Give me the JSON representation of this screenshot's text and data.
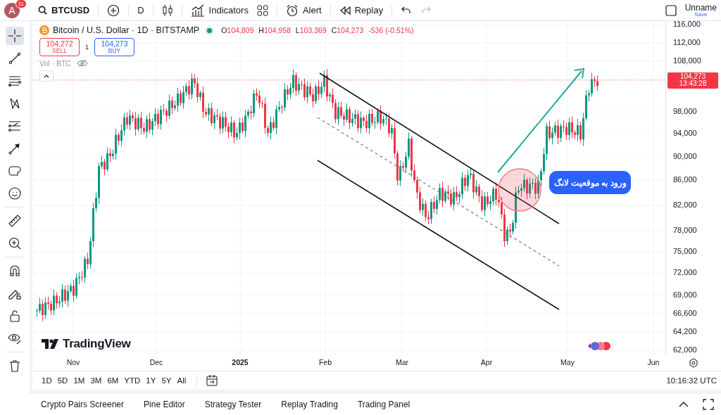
{
  "user": {
    "initial": "A",
    "badge": "11"
  },
  "toolbar": {
    "symbol": "BTCUSD",
    "interval": "D",
    "indicators": "Indicators",
    "alert": "Alert",
    "replay": "Replay",
    "redo_disabled": true
  },
  "layout": {
    "name": "Unname",
    "action": "Save"
  },
  "drawing_tools": [
    {
      "kind": "crosshair",
      "selected": true,
      "group_end": false
    },
    {
      "kind": "trend-line",
      "selected": false,
      "group_end": false
    },
    {
      "kind": "parallel-lines",
      "selected": false,
      "group_end": false
    },
    {
      "kind": "pattern",
      "selected": false,
      "group_end": false
    },
    {
      "kind": "projection",
      "selected": false,
      "group_end": false
    },
    {
      "kind": "arrow-line",
      "selected": false,
      "group_end": false
    },
    {
      "kind": "shape",
      "selected": false,
      "group_end": false
    },
    {
      "kind": "smiley",
      "selected": false,
      "group_end": true
    },
    {
      "kind": "ruler",
      "selected": false,
      "group_end": false
    },
    {
      "kind": "zoom",
      "selected": false,
      "group_end": true
    },
    {
      "kind": "magnet",
      "selected": false,
      "group_end": false
    },
    {
      "kind": "pencil-lock",
      "selected": false,
      "group_end": false
    },
    {
      "kind": "lock",
      "selected": false,
      "group_end": false
    },
    {
      "kind": "eye",
      "selected": false,
      "group_end": true
    },
    {
      "kind": "trash",
      "selected": false,
      "group_end": false
    }
  ],
  "legend": {
    "title": "Bitcoin / U.S. Dollar · 1D · BITSTAMP",
    "ohlc": [
      {
        "key": "O",
        "value": "104,809"
      },
      {
        "key": "H",
        "value": "104,958"
      },
      {
        "key": "L",
        "value": "103,369"
      },
      {
        "key": "C",
        "value": "104,273"
      }
    ],
    "change": "-536 (-0.51%)"
  },
  "trade": {
    "sell": {
      "price": "104,272",
      "label": "SELL"
    },
    "spread": "1",
    "buy": {
      "price": "104,273",
      "label": "BUY"
    }
  },
  "volume_label": "Vol · BTC",
  "brand": "TradingView",
  "annotation": "ورود به موقعیت لانگ",
  "price_axis": {
    "labels": [
      "116,000",
      "112,000",
      "108,000",
      "98,000",
      "94,000",
      "90,000",
      "86,000",
      "82,000",
      "78,000",
      "75,000",
      "72,000",
      "69,000",
      "66,600",
      "64,200",
      "62,000"
    ],
    "current_price": "104,273",
    "countdown": "13:43:28"
  },
  "time_axis": [
    {
      "label": "Nov",
      "kind": "month"
    },
    {
      "label": "Dec",
      "kind": "month"
    },
    {
      "label": "2025",
      "kind": "year"
    },
    {
      "label": "Feb",
      "kind": "month"
    },
    {
      "label": "Mar",
      "kind": "month"
    },
    {
      "label": "Apr",
      "kind": "month"
    },
    {
      "label": "May",
      "kind": "month"
    },
    {
      "label": "Jun",
      "kind": "month"
    }
  ],
  "ranges": [
    "1D",
    "5D",
    "1M",
    "3M",
    "6M",
    "YTD",
    "1Y",
    "5Y",
    "All"
  ],
  "clock": "10:16:32 UTC",
  "bottom_tabs": [
    "Crypto Pairs Screener",
    "Pine Editor",
    "Strategy Tester",
    "Replay Trading",
    "Trading Panel"
  ]
}
